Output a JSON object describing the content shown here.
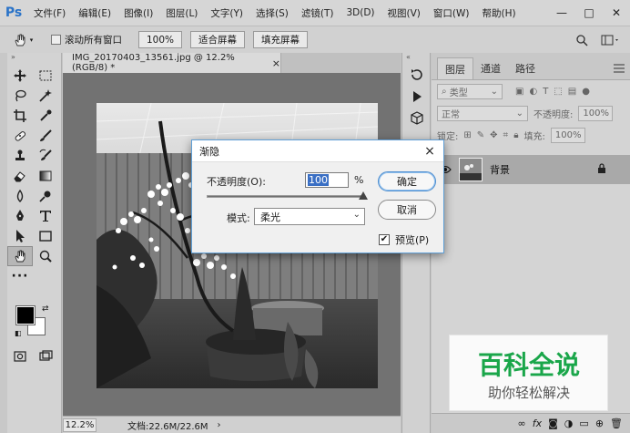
{
  "app": {
    "logo": "Ps"
  },
  "menu": {
    "items": [
      "文件(F)",
      "编辑(E)",
      "图像(I)",
      "图层(L)",
      "文字(Y)",
      "选择(S)",
      "滤镜(T)",
      "3D(D)",
      "视图(V)",
      "窗口(W)",
      "帮助(H)"
    ]
  },
  "window_controls": {
    "minimize": "—",
    "restore": "□",
    "close": "✕"
  },
  "options": {
    "scroll_all_label": "滚动所有窗口",
    "zoom_value": "100%",
    "fit_screen_label": "适合屏幕",
    "fill_screen_label": "填充屏幕"
  },
  "document": {
    "tab_title": "IMG_20170403_13561.jpg @ 12.2%(RGB/8) *",
    "tab_close": "×",
    "status_zoom": "12.2%",
    "status_doc_size": "文档:22.6M/22.6M",
    "status_arrow": "›"
  },
  "panels": {
    "tabs": [
      "图层",
      "通道",
      "路径"
    ],
    "active_tab": "图层",
    "filter_label": "类型",
    "blend_mode": "正常",
    "opacity_label": "不透明度:",
    "opacity_value": "100%",
    "lock_label": "锁定:",
    "fill_label": "填充:",
    "fill_value": "100%",
    "layer_name": "背景"
  },
  "dialog": {
    "title": "渐隐",
    "opacity_label": "不透明度(O):",
    "opacity_value": "100",
    "percent": "%",
    "opacity_level": 1.0,
    "mode_label": "模式:",
    "mode_value": "柔光",
    "ok_label": "确定",
    "cancel_label": "取消",
    "preview_label": "预览(P)",
    "preview_checked": true,
    "close": "×"
  },
  "watermark": {
    "title": "百科全说",
    "subtitle": "助你轻松解决"
  },
  "colors": {
    "accent": "#2a73c8",
    "watermark_green": "#1aa64a"
  }
}
